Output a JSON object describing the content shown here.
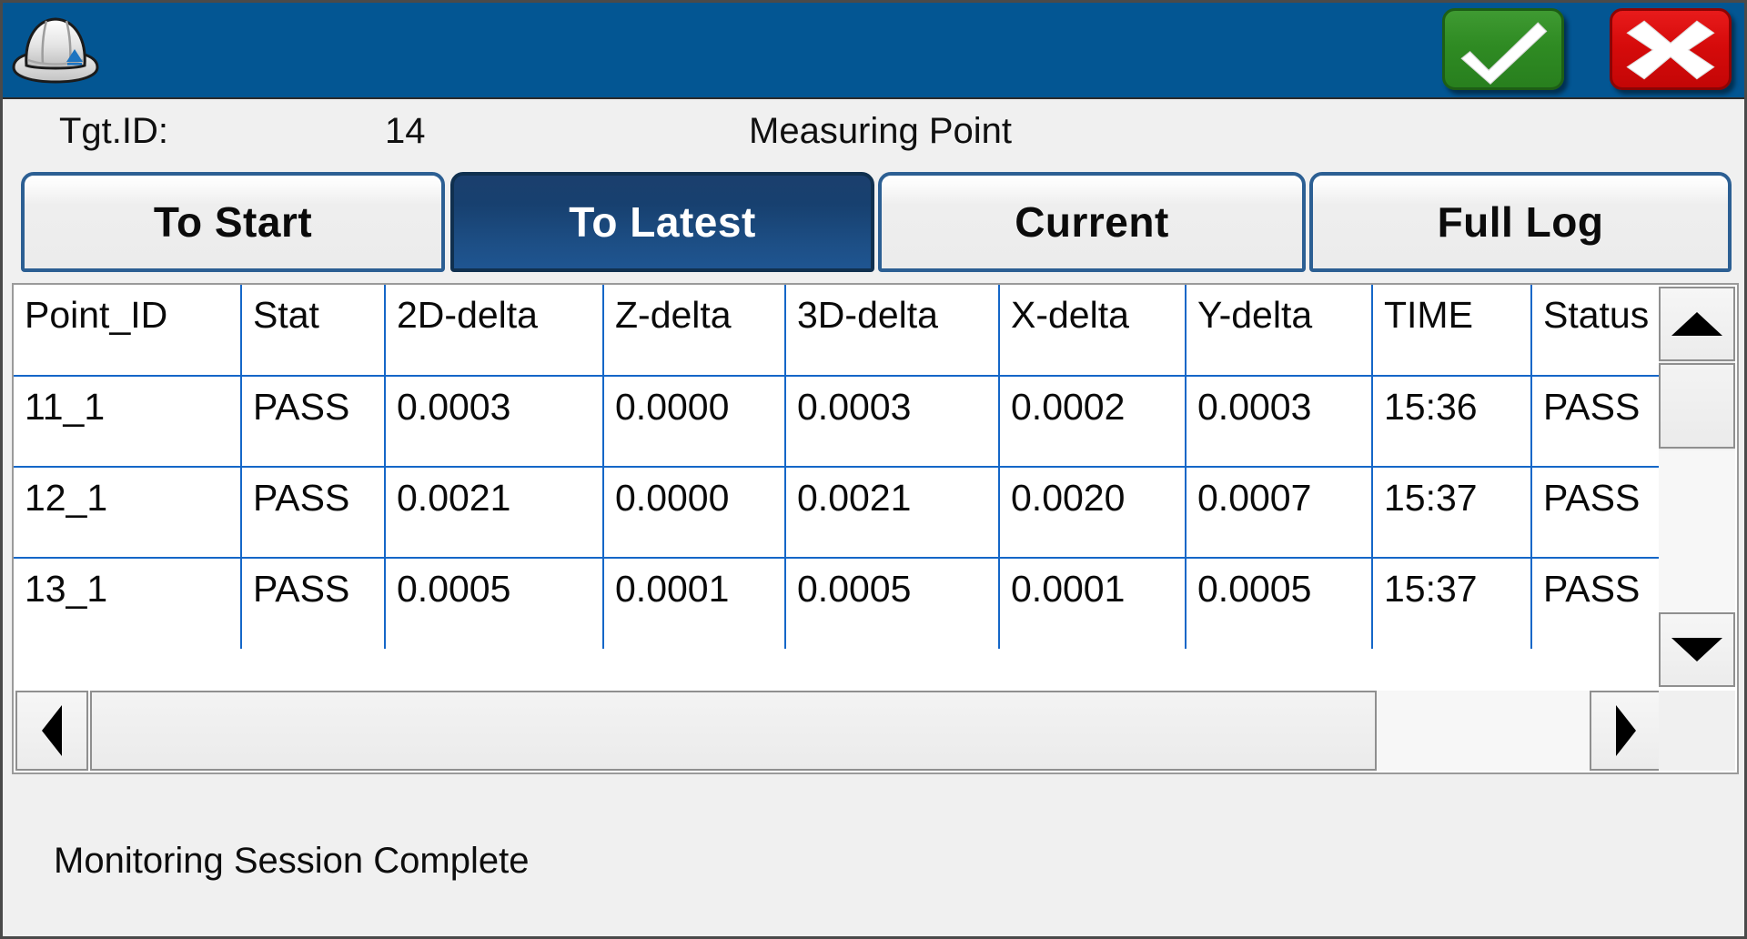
{
  "window": {
    "background_color": "#f0f0f0",
    "titlebar_color": "#035693"
  },
  "titlebar": {
    "logo_name": "hard-hat-logo",
    "accept_label": "OK",
    "accept_color": "#2f8b23",
    "cancel_label": "Cancel",
    "cancel_color": "#d60b0b"
  },
  "info": {
    "tgt_id_label": "Tgt.ID:",
    "tgt_id_value": "14",
    "title": "Measuring Point"
  },
  "tabs": {
    "active_index": 1,
    "items": [
      {
        "label": "To Start"
      },
      {
        "label": "To Latest"
      },
      {
        "label": "Current"
      },
      {
        "label": "Full Log"
      }
    ]
  },
  "table": {
    "columns": [
      "Point_ID",
      "Stat",
      "2D-delta",
      "Z-delta",
      "3D-delta",
      "X-delta",
      "Y-delta",
      "TIME",
      "Status"
    ],
    "rows": [
      [
        "11_1",
        "PASS",
        "0.0003",
        "0.0000",
        "0.0003",
        "0.0002",
        "0.0003",
        "15:36",
        "PASS"
      ],
      [
        "12_1",
        "PASS",
        "0.0021",
        "0.0000",
        "0.0021",
        "0.0020",
        "0.0007",
        "15:37",
        "PASS"
      ],
      [
        "13_1",
        "PASS",
        "0.0005",
        "0.0001",
        "0.0005",
        "0.0001",
        "0.0005",
        "15:37",
        "PASS"
      ]
    ],
    "grid_line_color": "#1567c8"
  },
  "scrollbars": {
    "vertical": {
      "up_icon": "triangle-up-icon",
      "down_icon": "triangle-down-icon"
    },
    "horizontal": {
      "left_icon": "triangle-left-icon",
      "right_icon": "triangle-right-icon"
    }
  },
  "status": {
    "message": "Monitoring Session Complete"
  }
}
